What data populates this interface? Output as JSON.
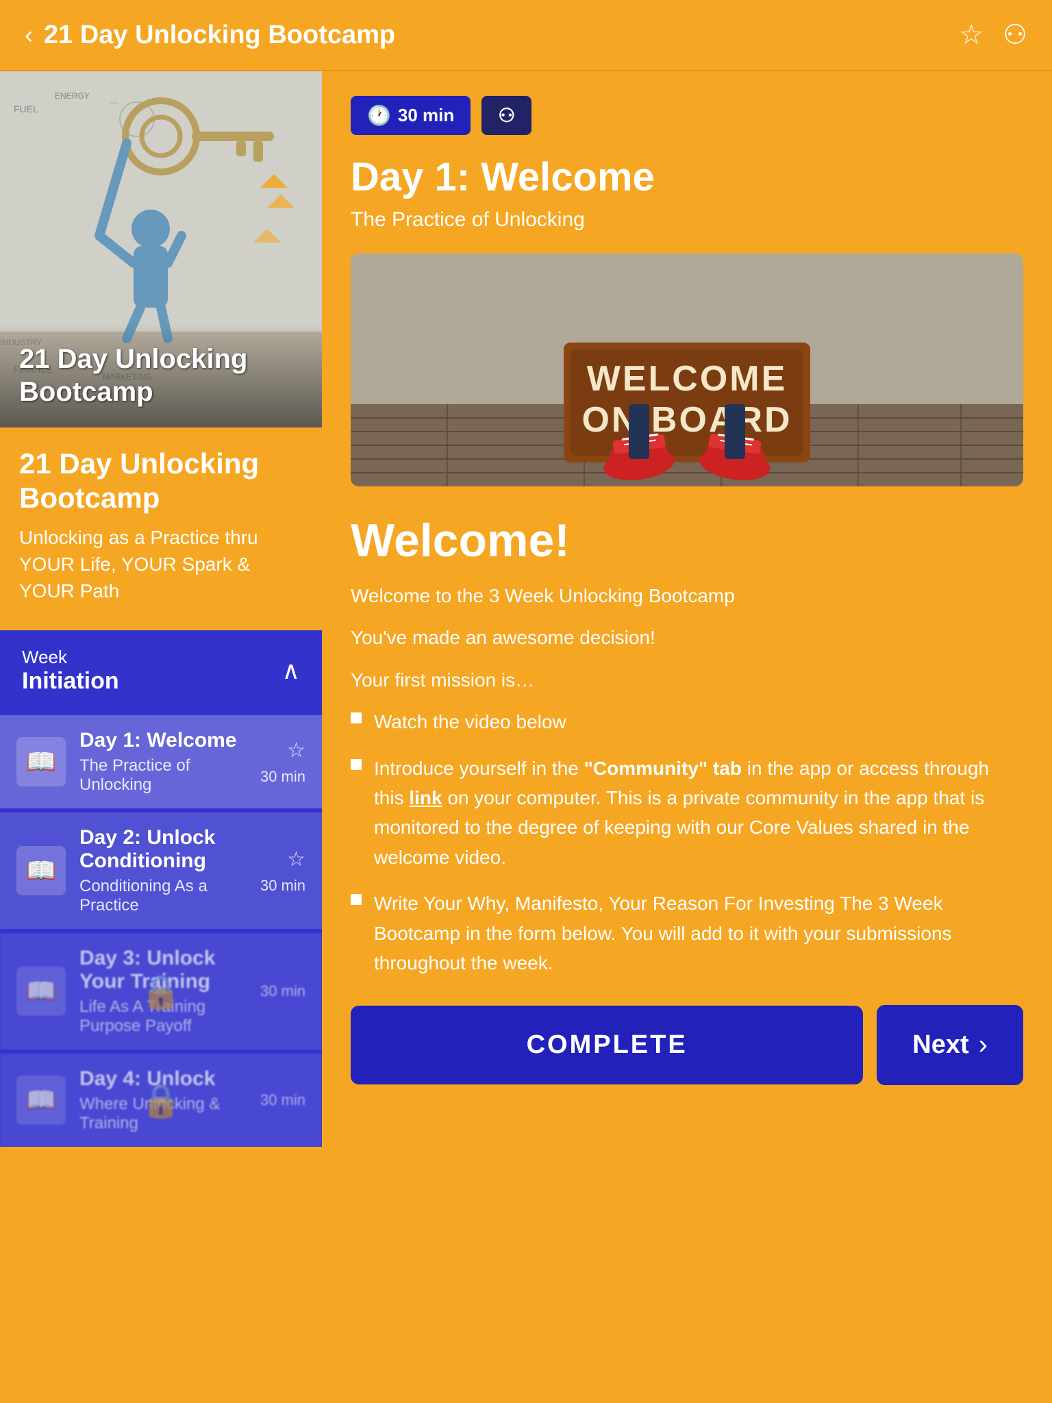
{
  "header": {
    "title": "21 Day Unlocking Bootcamp",
    "back_label": "‹",
    "bookmark_icon": "☆",
    "link_icon": "⚇"
  },
  "left": {
    "course_image_title": "21 Day Unlocking\nBootcamp",
    "course_name": "21 Day Unlocking Bootcamp",
    "course_subtitle": "Unlocking  as a Practice thru YOUR Life, YOUR Spark & YOUR Path",
    "week": {
      "label": "Week",
      "name": "Initiation",
      "chevron": "∧"
    },
    "days": [
      {
        "id": 1,
        "title": "Day 1: Welcome",
        "subtitle": "The Practice of Unlocking",
        "duration": "30 min",
        "locked": false,
        "active": true
      },
      {
        "id": 2,
        "title": "Day 2: Unlock Conditioning",
        "subtitle": "Conditioning As a Practice",
        "duration": "30 min",
        "locked": false,
        "active": false
      },
      {
        "id": 3,
        "title": "Day 3: Unlock Your Training",
        "subtitle": "Life As A Training Purpose\nPayoff",
        "duration": "30 min",
        "locked": true,
        "active": false
      },
      {
        "id": 4,
        "title": "Day 4: Unlock",
        "subtitle": "Where Unlocking & Training",
        "duration": "30 min",
        "locked": true,
        "active": false
      }
    ]
  },
  "right": {
    "duration_badge": "30 min",
    "clock_icon": "🕐",
    "link_icon": "⚇",
    "day_title": "Day 1: Welcome",
    "day_subtitle": "The Practice of Unlocking",
    "welcome_mat_line1": "WELCOME",
    "welcome_mat_line2": "ON BOARD",
    "welcome_heading": "Welcome!",
    "welcome_body": [
      "Welcome to the 3 Week Unlocking Bootcamp",
      "You've made an awesome decision!",
      "Your first mission is…"
    ],
    "bullets": [
      {
        "text": "Watch the video below"
      },
      {
        "text_parts": [
          {
            "text": "Introduce yourself in the ",
            "bold": false
          },
          {
            "text": "\"Community\" tab",
            "bold": true
          },
          {
            "text": " in the app or access through this ",
            "bold": false
          },
          {
            "text": "link",
            "bold": true,
            "underline": true
          },
          {
            "text": " on your computer. This is a private community in the app that is monitored to the degree of keeping with our Core Values shared in the welcome video.",
            "bold": false
          }
        ]
      },
      {
        "text": "Write Your Why, Manifesto, Your Reason For Investing The 3 Week Bootcamp in the form below. You will add to it with your submissions throughout the week."
      }
    ],
    "complete_label": "COMPLETE",
    "next_label": "Next",
    "chevron_right": "›"
  }
}
